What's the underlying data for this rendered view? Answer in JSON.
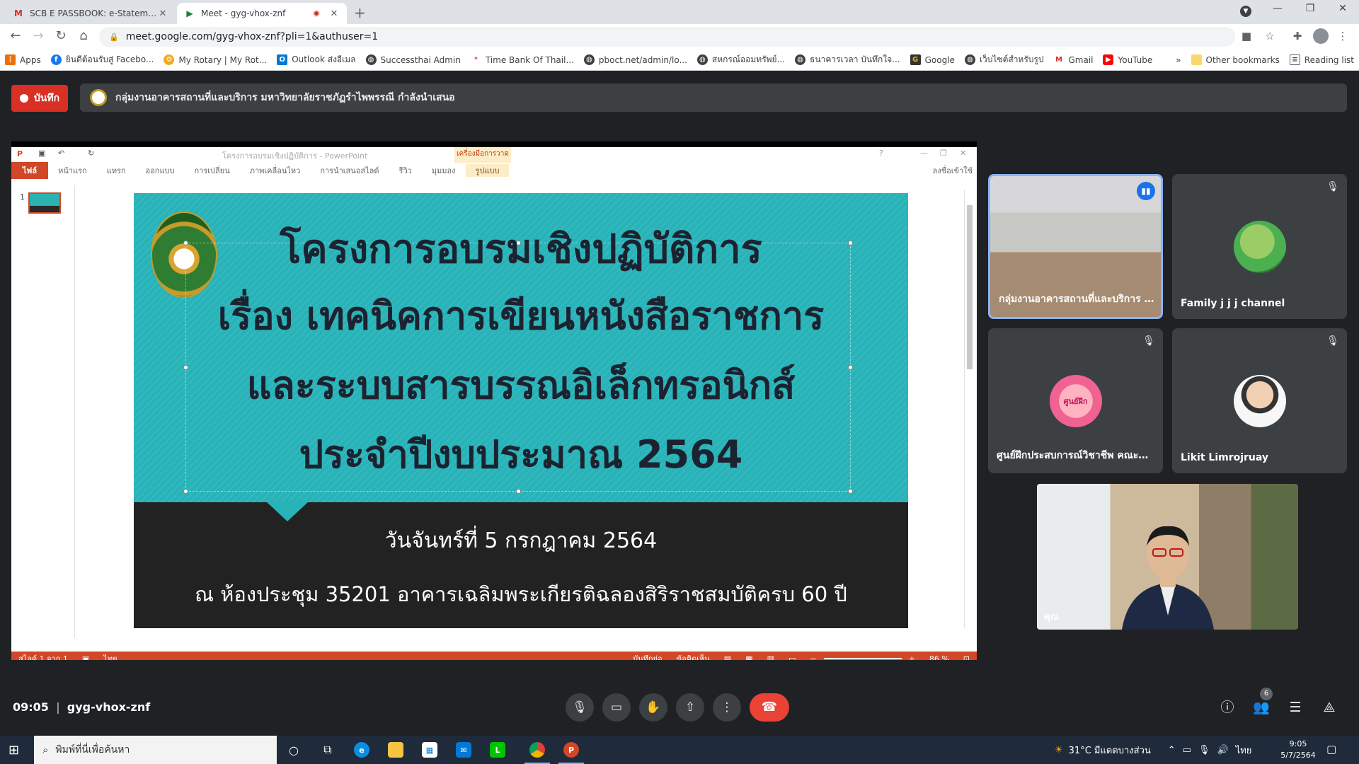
{
  "browser": {
    "tabs": [
      {
        "title": "SCB E PASSBOOK: e-Statement -",
        "favicon": "gmail-icon",
        "active": false
      },
      {
        "title": "Meet - gyg-vhox-znf",
        "favicon": "meet-icon",
        "active": true
      }
    ],
    "url": "meet.google.com/gyg-vhox-znf?pli=1&authuser=1",
    "bookmarks": [
      {
        "label": "Apps",
        "icon": "apps-grid-icon"
      },
      {
        "label": "ยินดีต้อนรับสู่ Facebo...",
        "icon": "facebook-icon"
      },
      {
        "label": "My Rotary | My Rot...",
        "icon": "rotary-icon"
      },
      {
        "label": "Outlook ส่งอีเมล",
        "icon": "outlook-icon"
      },
      {
        "label": "Successthai Admin",
        "icon": "globe-icon"
      },
      {
        "label": "Time Bank Of Thail...",
        "icon": "timebank-icon"
      },
      {
        "label": "pboct.net/admin/lo...",
        "icon": "globe-icon"
      },
      {
        "label": "สหกรณ์ออมทรัพย์...",
        "icon": "globe-icon"
      },
      {
        "label": "ธนาคารเวลา บันทึกใจ...",
        "icon": "globe-icon"
      },
      {
        "label": "Google",
        "icon": "google-icon"
      },
      {
        "label": "เว็บไซต์สำหรับรูป",
        "icon": "globe-icon"
      },
      {
        "label": "Gmail",
        "icon": "gmail-icon"
      },
      {
        "label": "YouTube",
        "icon": "youtube-icon"
      }
    ],
    "overflow": "»",
    "other_bookmarks": "Other bookmarks",
    "reading_list": "Reading list"
  },
  "meet": {
    "record_label": "บันทึก",
    "presenter_banner": "กลุ่มงานอาคารสถานที่และบริการ มหาวิทยาลัยราชภัฏรำไพพรรณี กำลังนำเสนอ",
    "time": "09:05",
    "meeting_code": "gyg-vhox-znf",
    "people_count": "6",
    "participants": [
      {
        "name": "กลุ่มงานอาคารสถานที่และบริการ ม...",
        "speaking": true
      },
      {
        "name": "Family j j j channel",
        "muted": true
      },
      {
        "name": "ศูนย์ฝึกประสบการณ์วิชาชีพ คณะวิท...",
        "muted": true,
        "avatar_text": "ศูนย์ฝึก"
      },
      {
        "name": "Likit Limrojruay",
        "muted": true
      }
    ],
    "self_label": "คุณ"
  },
  "powerpoint": {
    "window_title": "โครงการอบรมเชิงปฏิบัติการ - PowerPoint",
    "context_tab": "เครื่องมือการวาด",
    "ribbon_tabs": [
      "ไฟล์",
      "หน้าแรก",
      "แทรก",
      "ออกแบบ",
      "การเปลี่ยน",
      "ภาพเคลื่อนไหว",
      "การนำเสนอสไลด์",
      "รีวิว",
      "มุมมอง",
      "รูปแบบ"
    ],
    "signin": "ลงชื่อเข้าใช้",
    "slide_number": "1",
    "status": {
      "slide_pos": "สไลด์ 1 จาก 1",
      "language": "ไทย",
      "notes": "บันทึกย่อ",
      "comments": "ข้อคิดเห็น",
      "zoom": "86 %"
    },
    "slide": {
      "title_lines": [
        "โครงการอบรมเชิงปฏิบัติการ",
        "เรื่อง เทคนิคการเขียนหนังสือราชการ",
        "และระบบสารบรรณอิเล็กทรอนิกส์",
        "ประจำปีงบประมาณ 2564"
      ],
      "date_line": "วันจันทร์ที่ 5 กรกฎาคม 2564",
      "venue_line": "ณ ห้องประชุม 35201 อาคารเฉลิมพระเกียรติฉลองสิริราชสมบัติครบ 60 ปี"
    }
  },
  "taskbar": {
    "search_placeholder": "พิมพ์ที่นี่เพื่อค้นหา",
    "weather": "31°C มีแดดบางส่วน",
    "lang": "ไทย",
    "time": "9:05",
    "date": "5/7/2564"
  },
  "colors": {
    "meet_bg": "#202124",
    "record_red": "#d93025",
    "end_call_red": "#ea4335",
    "slide_teal": "#27b3b8",
    "ppt_orange": "#d24726"
  }
}
